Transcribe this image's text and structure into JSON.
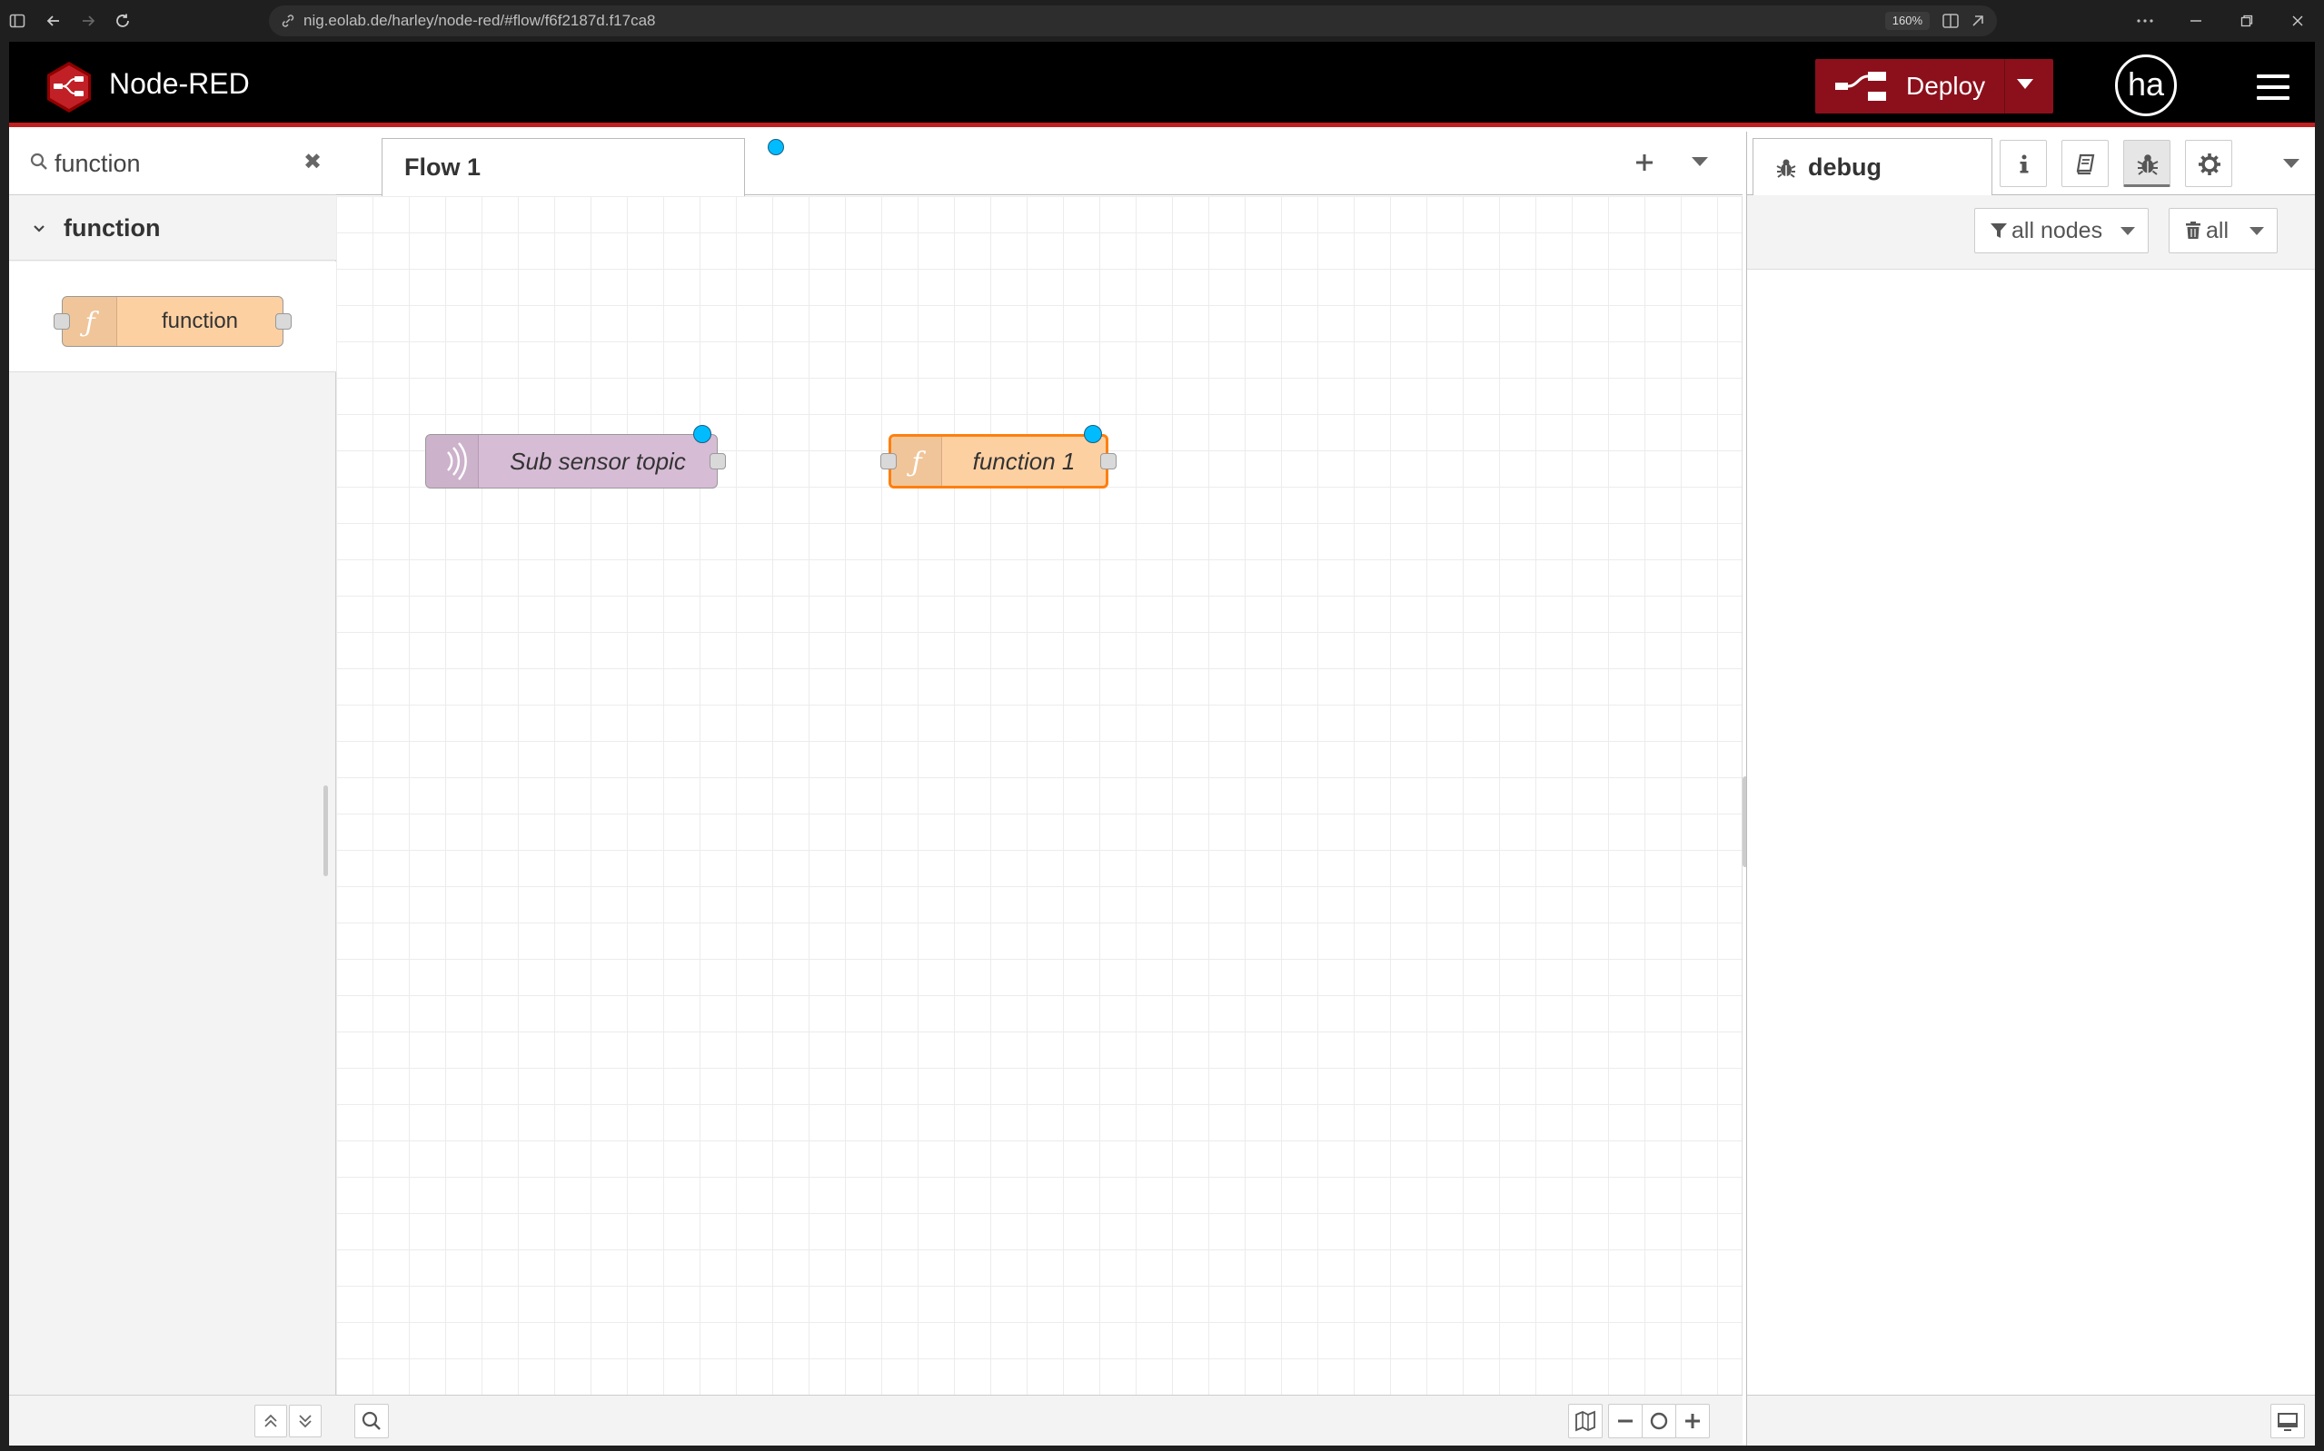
{
  "browser": {
    "url": "nig.eolab.de/harley/node-red/#flow/f6f2187d.f17ca8",
    "zoom": "160%"
  },
  "header": {
    "title": "Node-RED",
    "deploy_label": "Deploy",
    "user_initials": "ha"
  },
  "palette": {
    "search_value": "function",
    "category": "function",
    "node_label": "function"
  },
  "workspace": {
    "tab_label": "Flow 1",
    "nodes": [
      {
        "label": "Sub sensor topic",
        "type": "mqtt-in",
        "color": "#d7bcd6"
      },
      {
        "label": "function 1",
        "type": "function",
        "color": "#fdd0a2"
      }
    ]
  },
  "sidebar": {
    "active_tab": "debug",
    "filter_nodes": "all nodes",
    "clear_all": "all"
  },
  "colors": {
    "header_bg": "#000000",
    "deploy_red": "#8c101c",
    "changed_dot": "#00bcff",
    "selected_outline": "#ff7f0e"
  }
}
